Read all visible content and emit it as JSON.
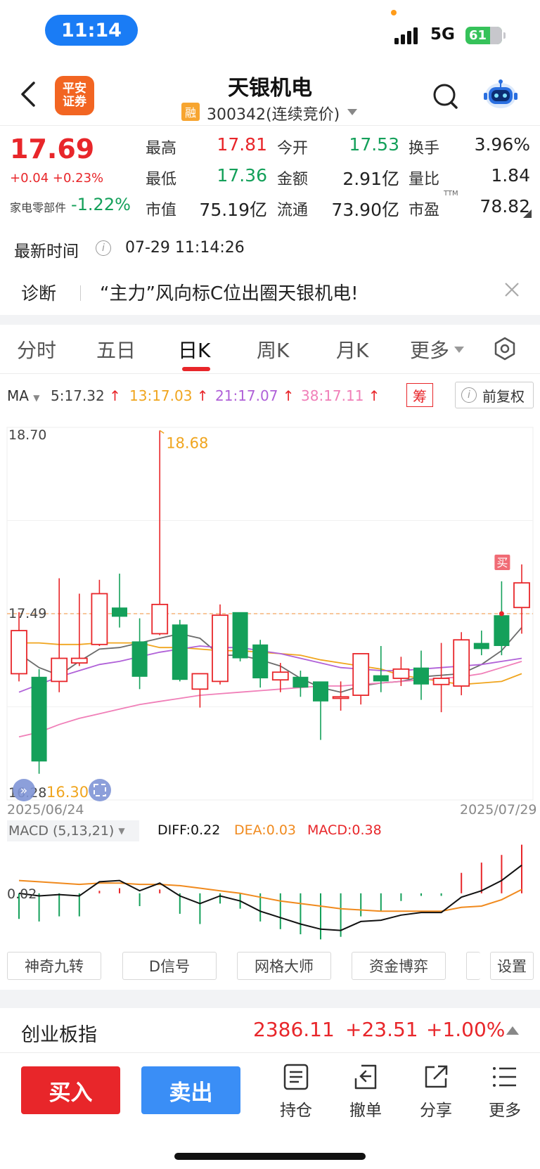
{
  "status_bar": {
    "time": "11:14",
    "network": "5G",
    "battery": "61"
  },
  "header": {
    "logo_line1": "平安",
    "logo_line2": "证券",
    "stock_name": "天银机电",
    "margin_badge": "融",
    "code": "300342(连续竞价)"
  },
  "quote": {
    "price": "17.69",
    "change": "+0.04 +0.23%",
    "sector_name": "家电零部件",
    "sector_change": "-1.22%",
    "fields": [
      {
        "label": "最高",
        "value": "17.81",
        "color": "red"
      },
      {
        "label": "今开",
        "value": "17.53",
        "color": "green"
      },
      {
        "label": "换手",
        "value": "3.96%",
        "color": "black"
      },
      {
        "label": "最低",
        "value": "17.36",
        "color": "green"
      },
      {
        "label": "金额",
        "value": "2.91亿",
        "color": "black"
      },
      {
        "label": "量比",
        "value": "1.84",
        "color": "black"
      },
      {
        "label": "市值",
        "value": "75.19亿",
        "color": "black"
      },
      {
        "label": "流通",
        "value": "73.90亿",
        "color": "black"
      },
      {
        "label": "市盈",
        "value": "78.82",
        "color": "black"
      }
    ],
    "pe_superscript": "TTM",
    "latest_time_label": "最新时间",
    "latest_time_value": "07-29 11:14:26"
  },
  "diagnosis": {
    "label": "诊断",
    "text": "“主力”风向标C位出圈天银机电!"
  },
  "tabs": {
    "items": [
      "分时",
      "五日",
      "日K",
      "周K",
      "月K",
      "更多"
    ],
    "active": "日K"
  },
  "ma": {
    "label": "MA",
    "items": [
      {
        "text": "5:17.32",
        "color": "#444444"
      },
      {
        "text": "13:17.03",
        "color": "#f0a51e"
      },
      {
        "text": "21:17.07",
        "color": "#b061d8"
      },
      {
        "text": "38:17.11",
        "color": "#f07fb8"
      }
    ],
    "chip_badge": "筹",
    "adjust_label": "前复权"
  },
  "chart_data": {
    "type": "candlestick",
    "y_axis_labels": [
      "18.70",
      "17.49",
      "16.28"
    ],
    "ylim": [
      16.28,
      18.7
    ],
    "reference_price": 17.49,
    "high_label": "18.68",
    "low_label": "16.30",
    "buy_marker": "买",
    "date_start": "2025/06/24",
    "date_end": "2025/07/29",
    "candles": [
      {
        "o": 17.1,
        "h": 17.5,
        "c": 17.38,
        "l": 17.05
      },
      {
        "o": 17.08,
        "h": 17.13,
        "c": 16.53,
        "l": 16.45
      },
      {
        "o": 17.05,
        "h": 17.72,
        "c": 17.2,
        "l": 16.98
      },
      {
        "o": 17.17,
        "h": 17.62,
        "c": 17.2,
        "l": 17.15
      },
      {
        "o": 17.29,
        "h": 17.71,
        "c": 17.62,
        "l": 17.28
      },
      {
        "o": 17.53,
        "h": 17.75,
        "c": 17.47,
        "l": 17.4
      },
      {
        "o": 17.31,
        "h": 17.46,
        "c": 17.08,
        "l": 17.0
      },
      {
        "o": 17.36,
        "h": 18.68,
        "c": 17.55,
        "l": 17.35
      },
      {
        "o": 17.42,
        "h": 17.45,
        "c": 17.06,
        "l": 17.05
      },
      {
        "o": 17.0,
        "h": 17.09,
        "c": 17.1,
        "l": 16.88
      },
      {
        "o": 17.05,
        "h": 17.55,
        "c": 17.48,
        "l": 17.03
      },
      {
        "o": 17.5,
        "h": 17.49,
        "c": 17.2,
        "l": 17.18
      },
      {
        "o": 17.29,
        "h": 17.32,
        "c": 17.07,
        "l": 17.01
      },
      {
        "o": 17.06,
        "h": 17.17,
        "c": 17.11,
        "l": 16.98
      },
      {
        "o": 17.08,
        "h": 17.12,
        "c": 17.01,
        "l": 16.95
      },
      {
        "o": 17.05,
        "h": 17.03,
        "c": 16.92,
        "l": 16.67
      },
      {
        "o": 16.94,
        "h": 17.05,
        "c": 16.95,
        "l": 16.86
      },
      {
        "o": 16.96,
        "h": 17.23,
        "c": 17.23,
        "l": 16.9
      },
      {
        "o": 17.09,
        "h": 17.28,
        "c": 17.05,
        "l": 16.98
      },
      {
        "o": 17.07,
        "h": 17.21,
        "c": 17.13,
        "l": 17.02
      },
      {
        "o": 17.14,
        "h": 17.25,
        "c": 17.03,
        "l": 16.93
      },
      {
        "o": 17.03,
        "h": 17.3,
        "c": 17.07,
        "l": 16.85
      },
      {
        "o": 17.02,
        "h": 17.37,
        "c": 17.32,
        "l": 16.96
      },
      {
        "o": 17.3,
        "h": 17.38,
        "c": 17.26,
        "l": 17.22
      },
      {
        "o": 17.48,
        "h": 17.7,
        "c": 17.28,
        "l": 17.22
      },
      {
        "o": 17.53,
        "h": 17.81,
        "c": 17.69,
        "l": 17.36
      }
    ],
    "ma_series": [
      {
        "period": 5,
        "color": "#6b6b6b",
        "values": [
          17.23,
          17.14,
          17.09,
          17.18,
          17.26,
          17.27,
          17.3,
          17.33,
          17.36,
          17.33,
          17.22,
          17.22,
          17.19,
          17.15,
          17.07,
          17.01,
          16.98,
          17.02,
          17.04,
          17.05,
          17.08,
          17.09,
          17.1,
          17.16,
          17.25,
          17.4
        ]
      },
      {
        "period": 13,
        "color": "#f0a51e",
        "values": [
          17.3,
          17.3,
          17.29,
          17.29,
          17.3,
          17.3,
          17.3,
          17.27,
          17.27,
          17.26,
          17.25,
          17.25,
          17.24,
          17.23,
          17.22,
          17.19,
          17.17,
          17.15,
          17.13,
          17.09,
          17.07,
          17.05,
          17.03,
          17.04,
          17.05,
          17.1
        ]
      },
      {
        "period": 21,
        "color": "#b061d8",
        "values": [
          16.98,
          17.03,
          17.08,
          17.12,
          17.16,
          17.18,
          17.21,
          17.24,
          17.26,
          17.28,
          17.27,
          17.27,
          17.25,
          17.23,
          17.2,
          17.17,
          17.14,
          17.13,
          17.12,
          17.12,
          17.13,
          17.14,
          17.15,
          17.16,
          17.18,
          17.2
        ]
      },
      {
        "period": 38,
        "color": "#f07fb8",
        "values": [
          16.69,
          16.72,
          16.77,
          16.81,
          16.84,
          16.87,
          16.9,
          16.92,
          16.94,
          16.96,
          16.97,
          16.98,
          16.99,
          17.0,
          17.01,
          17.02,
          17.02,
          17.03,
          17.04,
          17.05,
          17.06,
          17.07,
          17.08,
          17.1,
          17.14,
          17.18
        ]
      }
    ],
    "macd": {
      "label": "MACD (5,13,21)",
      "diff_label": "DIFF:0.22",
      "dea_label": "DEA:0.03",
      "macd_label": "MACD:0.38",
      "axis_label": "0.02",
      "diff": [
        0.0,
        -0.02,
        -0.01,
        -0.02,
        0.09,
        0.1,
        0.02,
        0.08,
        -0.02,
        -0.08,
        -0.02,
        -0.06,
        -0.14,
        -0.19,
        -0.24,
        -0.28,
        -0.29,
        -0.22,
        -0.21,
        -0.17,
        -0.15,
        -0.15,
        -0.03,
        0.02,
        0.1,
        0.22
      ],
      "dea": [
        0.1,
        0.09,
        0.08,
        0.07,
        0.08,
        0.08,
        0.07,
        0.07,
        0.06,
        0.04,
        0.02,
        0.0,
        -0.03,
        -0.06,
        -0.08,
        -0.1,
        -0.12,
        -0.13,
        -0.14,
        -0.14,
        -0.14,
        -0.14,
        -0.11,
        -0.1,
        -0.05,
        0.03
      ],
      "bars": [
        -0.2,
        -0.22,
        -0.18,
        -0.18,
        0.02,
        0.04,
        -0.1,
        0.03,
        -0.16,
        -0.24,
        -0.08,
        -0.12,
        -0.22,
        -0.28,
        -0.32,
        -0.36,
        -0.34,
        -0.18,
        -0.14,
        -0.06,
        -0.02,
        -0.02,
        0.16,
        0.24,
        0.3,
        0.38
      ]
    }
  },
  "indicators": [
    "神奇九转",
    "D信号",
    "网格大师",
    "资金博弈",
    "设置"
  ],
  "index_bar": {
    "name": "创业板指",
    "value": "2386.11",
    "change": "+23.51",
    "percent": "+1.00%"
  },
  "bottom_bar": {
    "buy": "买入",
    "sell": "卖出",
    "items": [
      {
        "label": "持仓",
        "icon": "list-icon"
      },
      {
        "label": "撤单",
        "icon": "undo-icon"
      },
      {
        "label": "分享",
        "icon": "share-icon"
      },
      {
        "label": "更多",
        "icon": "menu-icon"
      }
    ]
  },
  "colors": {
    "up": "#e8262a",
    "down": "#14a05a",
    "accent": "#3a8ef6"
  }
}
